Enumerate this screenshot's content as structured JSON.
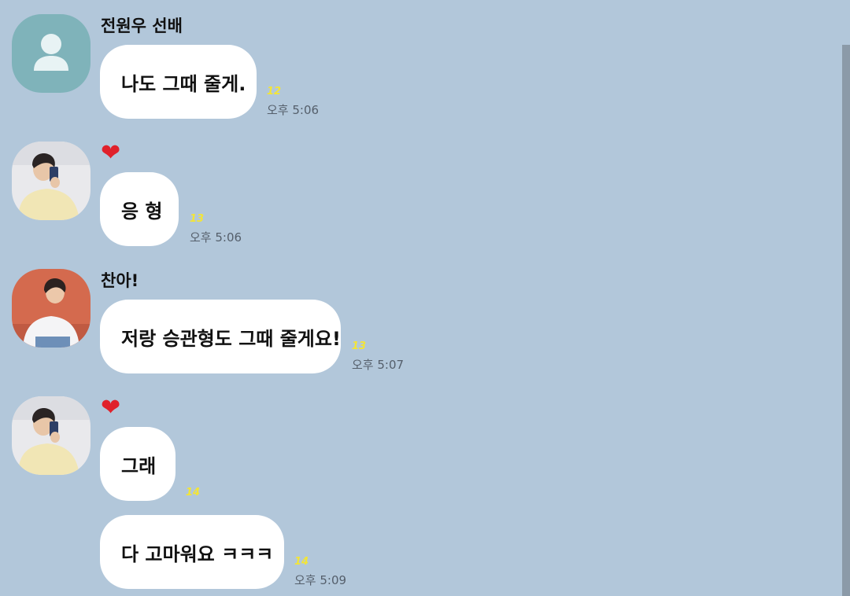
{
  "messages": [
    {
      "sender": "전원우 선배",
      "avatar": "default-person",
      "text": "나도 그때 줄게.",
      "unread": "12",
      "time": "오후 5:06"
    },
    {
      "sender_icon": "heart",
      "sender_glyph": "❤",
      "avatar": "photo-selfie",
      "text": "응 형",
      "unread": "13",
      "time": "오후 5:06"
    },
    {
      "sender": "찬아!",
      "avatar": "photo-red-background",
      "text": "저랑 승관형도 그때 줄게요!",
      "unread": "13",
      "time": "오후 5:07"
    },
    {
      "sender_icon": "heart",
      "sender_glyph": "❤",
      "avatar": "photo-selfie",
      "text": "그래",
      "unread": "14"
    },
    {
      "text": "다 고마워요 ㅋㅋㅋ",
      "unread": "14",
      "time": "오후 5:09"
    }
  ],
  "colors": {
    "background": "#b2c7da",
    "bubble": "#ffffff",
    "unread": "#f3e537",
    "heart": "#e0212b",
    "default_avatar": "#7fb3ba"
  }
}
